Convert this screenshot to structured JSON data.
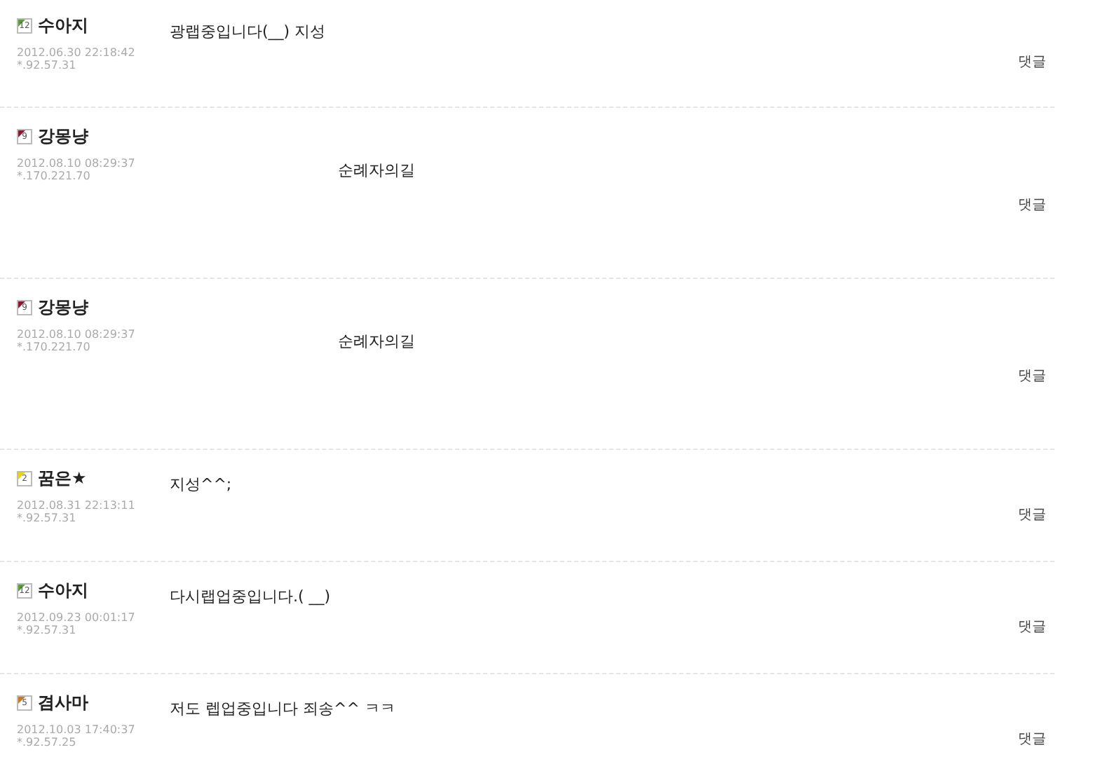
{
  "comments": [
    {
      "kind": "short",
      "level_badge": "12",
      "color": "#5a9e3a",
      "name": "수아지",
      "date": "2012.06.30 22:18:42",
      "ip": "*.92.57.31",
      "message": "광랩중입니다(__) 지성",
      "reply": "댓글"
    },
    {
      "kind": "tall",
      "level_badge": "9",
      "color": "#8b1a2a",
      "name": "강몽냥",
      "date": "2012.08.10 08:29:37",
      "ip": "*.170.221.70",
      "message": "순례자의길",
      "reply": "댓글"
    },
    {
      "kind": "tall",
      "level_badge": "9",
      "color": "#8b1a2a",
      "name": "강몽냥",
      "date": "2012.08.10 08:29:37",
      "ip": "*.170.221.70",
      "message": "순례자의길",
      "reply": "댓글"
    },
    {
      "kind": "short",
      "level_badge": "2",
      "color": "#e8d21a",
      "name": "꿈은★",
      "date": "2012.08.31 22:13:11",
      "ip": "*.92.57.31",
      "message": "지성^^;",
      "reply": "댓글"
    },
    {
      "kind": "short",
      "level_badge": "12",
      "color": "#5a9e3a",
      "name": "수아지",
      "date": "2012.09.23 00:01:17",
      "ip": "*.92.57.31",
      "message": "다시랩업중입니다.( __)",
      "reply": "댓글"
    },
    {
      "kind": "short",
      "level_badge": "5",
      "color": "#c8782a",
      "name": "겸사마",
      "date": "2012.10.03 17:40:37",
      "ip": "*.92.57.25",
      "message": "저도 렙업중입니다 죄송^^ ㅋㅋ",
      "reply": "댓글"
    }
  ]
}
